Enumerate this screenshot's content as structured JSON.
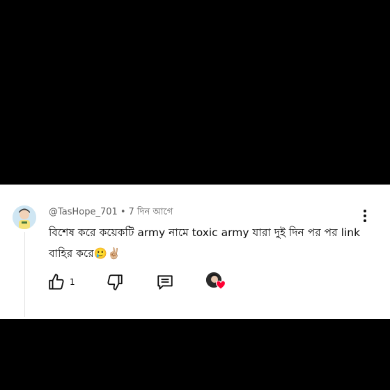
{
  "comment": {
    "author": "@TasHope_701",
    "separator": "•",
    "time": "7 দিন আগে",
    "text": "বিশেষ করে কয়েকটি army নামে toxic army যারা দুই দিন পর পর link বাহির করে🥲✌🏼",
    "like_count": "1"
  },
  "icons": {
    "avatar": "user-avatar",
    "more": "more-vert-icon",
    "like": "thumb-up-icon",
    "dislike": "thumb-down-icon",
    "reply": "comment-reply-icon",
    "creator_heart": "creator-heart-icon"
  },
  "colors": {
    "background": "#000000",
    "card": "#ffffff",
    "text": "#0f0f0f",
    "meta": "#606060",
    "heart": "#ff0033"
  }
}
